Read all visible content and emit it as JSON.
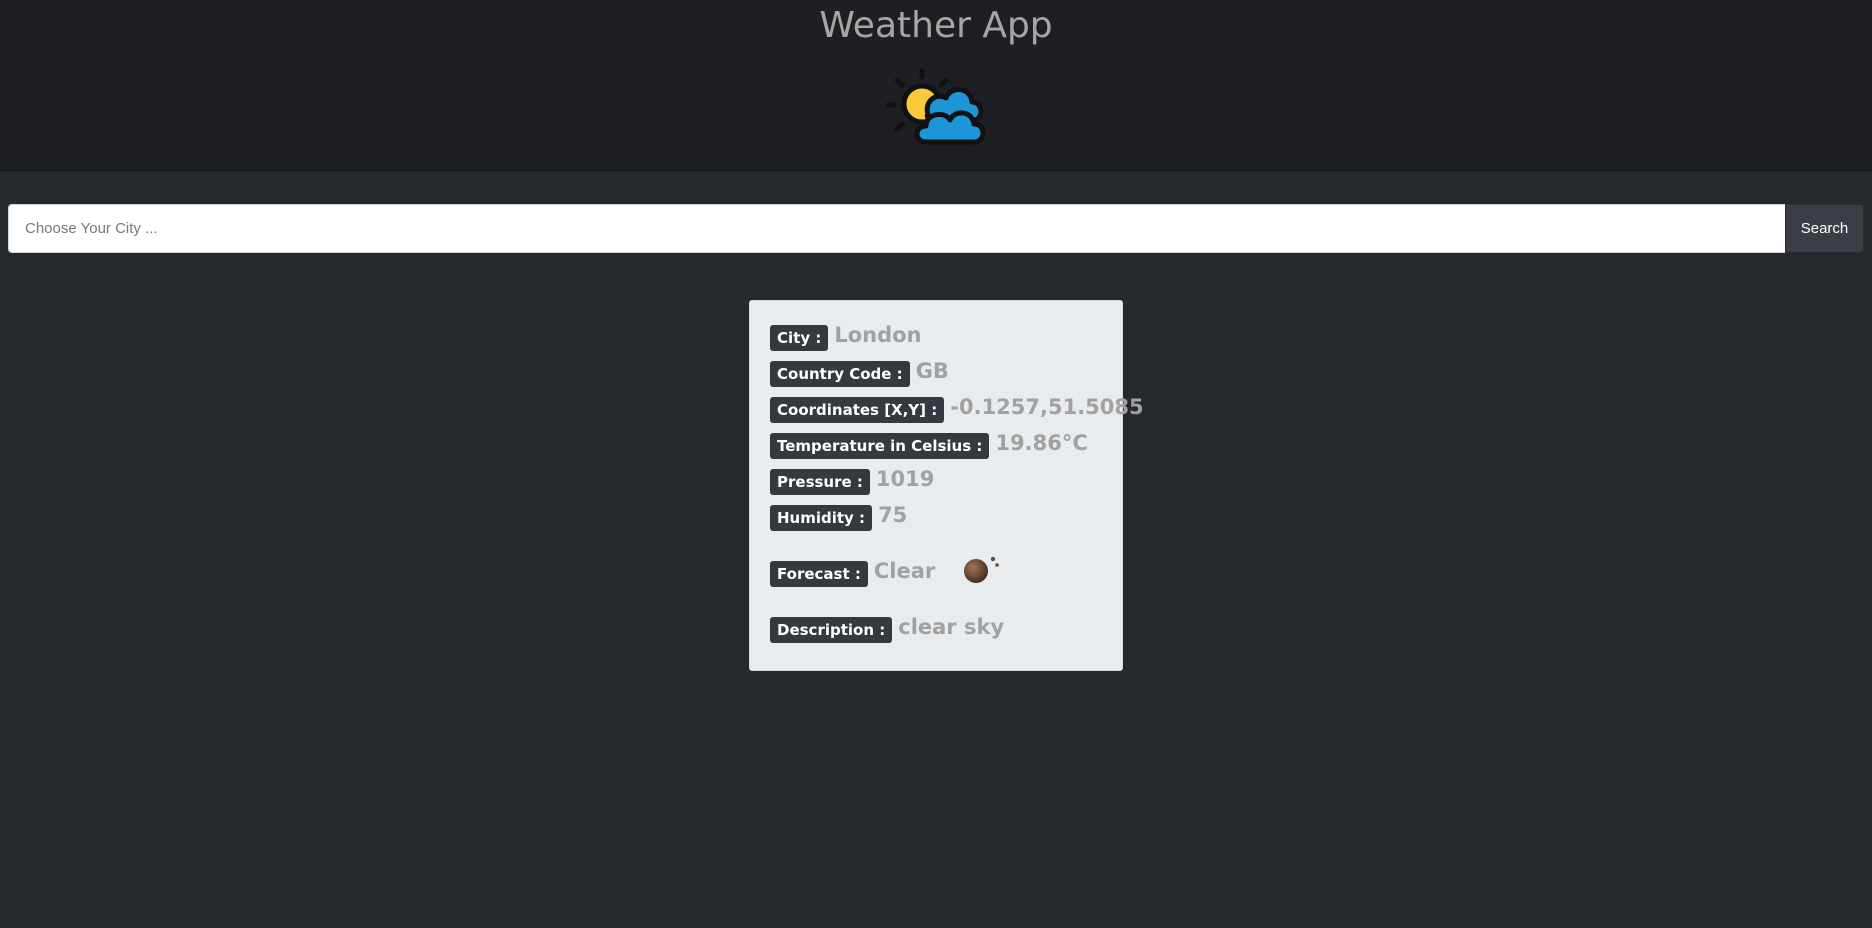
{
  "header": {
    "title": "Weather App",
    "logo_icon": "sun-behind-cloud-icon"
  },
  "search": {
    "placeholder": "Choose Your City ...",
    "value": "",
    "button_label": "Search"
  },
  "weather": {
    "city_label": "City :",
    "city": "London",
    "country_label": "Country Code :",
    "country": "GB",
    "coords_label": "Coordinates [X,Y] :",
    "coords": "-0.1257,51.5085",
    "temp_label": "Temperature in Celsius :",
    "temp": "19.86°C",
    "pressure_label": "Pressure :",
    "pressure": "1019",
    "humidity_label": "Humidity :",
    "humidity": "75",
    "forecast_label": "Forecast :",
    "forecast": "Clear",
    "forecast_icon": "clear-sky-icon",
    "description_label": "Description :",
    "description": "clear sky"
  },
  "colors": {
    "header_bg": "#1e1f22",
    "page_bg": "#25292e",
    "card_bg": "#e9ecef",
    "badge_bg": "#343a40",
    "value_text": "#a1a1a1",
    "sun": "#fcc93a",
    "cloud": "#1c96d6"
  }
}
